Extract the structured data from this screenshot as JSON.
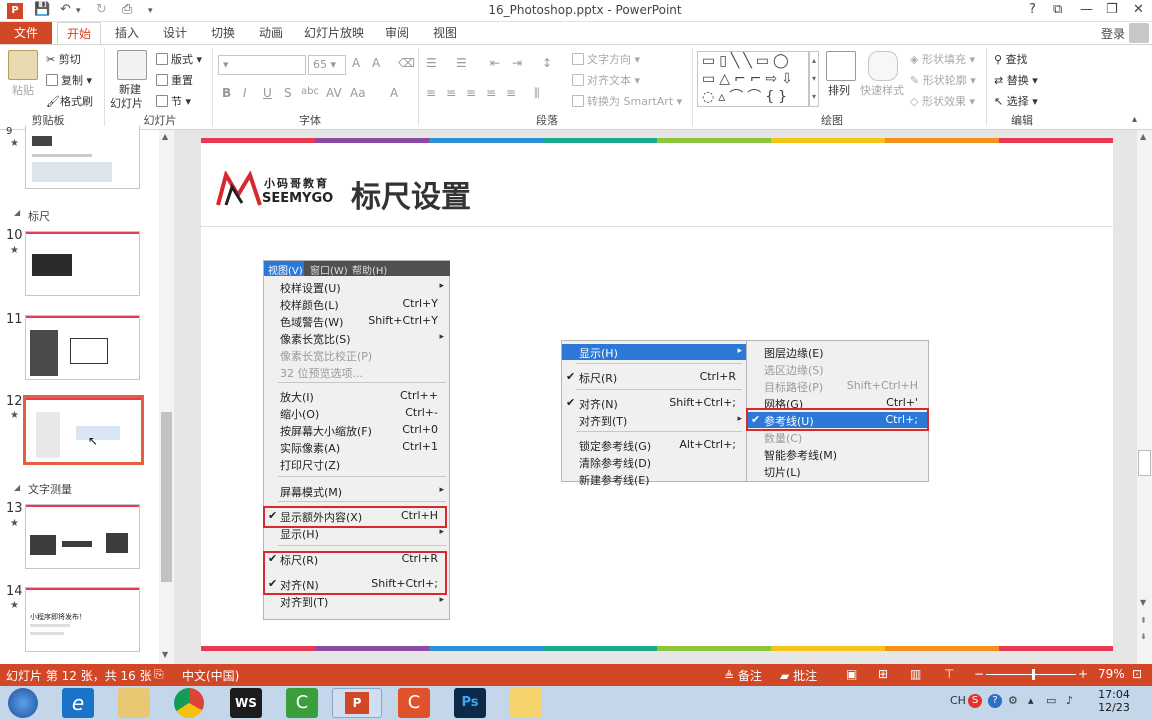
{
  "window": {
    "title": "16_Photoshop.pptx - PowerPoint",
    "app_icon": "P",
    "controls": [
      "?",
      "⧉",
      "—",
      "❐",
      "✕"
    ]
  },
  "tabs": {
    "file": "文件",
    "items": [
      "开始",
      "插入",
      "设计",
      "切换",
      "动画",
      "幻灯片放映",
      "审阅",
      "视图"
    ],
    "active_index": 0,
    "login": "登录"
  },
  "ribbon": {
    "clipboard": {
      "paste": "粘贴",
      "cut": "剪切",
      "copy": "复制",
      "format_painter": "格式刷",
      "label": "剪贴板"
    },
    "slides": {
      "new_slide": "新建",
      "new_slide2": "幻灯片",
      "layout": "版式",
      "reset": "重置",
      "section": "节",
      "label": "幻灯片"
    },
    "font": {
      "size": "65",
      "label": "字体"
    },
    "paragraph": {
      "text_direction": "文字方向",
      "align_text": "对齐文本",
      "convert_smartart": "转换为 SmartArt",
      "label": "段落"
    },
    "drawing": {
      "arrange": "排列",
      "quick_styles": "快速样式",
      "shape_fill": "形状填充",
      "shape_outline": "形状轮廓",
      "shape_effects": "形状效果",
      "label": "绘图"
    },
    "editing": {
      "find": "查找",
      "replace": "替换",
      "select": "选择",
      "label": "编辑"
    }
  },
  "panel": {
    "section_ruler": "标尺",
    "section_text": "文字测量",
    "slides": [
      {
        "num": "9",
        "star": "★"
      },
      {
        "num": "10",
        "star": "★"
      },
      {
        "num": "11",
        "star": ""
      },
      {
        "num": "12",
        "star": "★"
      },
      {
        "num": "13",
        "star": "★"
      },
      {
        "num": "14",
        "star": "★"
      }
    ],
    "thumb14_text": "小程序即将发布！"
  },
  "slide": {
    "logo_cn": "小码哥教育",
    "logo_en": "SEEMYGO",
    "title": "标尺设置",
    "rainbow": [
      "#e73b55",
      "#8a4aa3",
      "#2e8fd3",
      "#1aab8f",
      "#8cc63f",
      "#f5c419",
      "#f39020",
      "#e73b55"
    ],
    "menu1": {
      "bar": [
        "视图(V)",
        "窗口(W)",
        "帮助(H)"
      ],
      "items": [
        {
          "label": "校样设置(U)",
          "shortcut": "",
          "arrow": "▸",
          "dim": false,
          "check": ""
        },
        {
          "label": "校样颜色(L)",
          "shortcut": "Ctrl+Y",
          "arrow": "",
          "dim": false,
          "check": ""
        },
        {
          "label": "色域警告(W)",
          "shortcut": "Shift+Ctrl+Y",
          "arrow": "",
          "dim": false,
          "check": ""
        },
        {
          "label": "像素长宽比(S)",
          "shortcut": "",
          "arrow": "▸",
          "dim": false,
          "check": ""
        },
        {
          "label": "像素长宽比校正(P)",
          "shortcut": "",
          "arrow": "",
          "dim": true,
          "check": ""
        },
        {
          "label": "32 位预览选项...",
          "shortcut": "",
          "arrow": "",
          "dim": true,
          "check": ""
        },
        {
          "label": "放大(I)",
          "shortcut": "Ctrl++",
          "arrow": "",
          "dim": false,
          "check": ""
        },
        {
          "label": "缩小(O)",
          "shortcut": "Ctrl+-",
          "arrow": "",
          "dim": false,
          "check": ""
        },
        {
          "label": "按屏幕大小缩放(F)",
          "shortcut": "Ctrl+0",
          "arrow": "",
          "dim": false,
          "check": ""
        },
        {
          "label": "实际像素(A)",
          "shortcut": "Ctrl+1",
          "arrow": "",
          "dim": false,
          "check": ""
        },
        {
          "label": "打印尺寸(Z)",
          "shortcut": "",
          "arrow": "",
          "dim": false,
          "check": ""
        },
        {
          "label": "屏幕模式(M)",
          "shortcut": "",
          "arrow": "▸",
          "dim": false,
          "check": ""
        },
        {
          "label": "显示额外内容(X)",
          "shortcut": "Ctrl+H",
          "arrow": "",
          "dim": false,
          "check": "✔"
        },
        {
          "label": "显示(H)",
          "shortcut": "",
          "arrow": "▸",
          "dim": false,
          "check": ""
        },
        {
          "label": "标尺(R)",
          "shortcut": "Ctrl+R",
          "arrow": "",
          "dim": false,
          "check": "✔"
        },
        {
          "label": "对齐(N)",
          "shortcut": "Shift+Ctrl+;",
          "arrow": "",
          "dim": false,
          "check": "✔"
        },
        {
          "label": "对齐到(T)",
          "shortcut": "",
          "arrow": "▸",
          "dim": false,
          "check": ""
        }
      ]
    },
    "menu2": {
      "left": [
        {
          "label": "显示(H)",
          "shortcut": "",
          "arrow": "▸",
          "check": ""
        },
        {
          "label": "标尺(R)",
          "shortcut": "Ctrl+R",
          "arrow": "",
          "check": "✔"
        },
        {
          "label": "对齐(N)",
          "shortcut": "Shift+Ctrl+;",
          "arrow": "",
          "check": "✔"
        },
        {
          "label": "对齐到(T)",
          "shortcut": "",
          "arrow": "▸",
          "check": ""
        },
        {
          "label": "锁定参考线(G)",
          "shortcut": "Alt+Ctrl+;",
          "arrow": "",
          "check": ""
        },
        {
          "label": "清除参考线(D)",
          "shortcut": "",
          "arrow": "",
          "check": ""
        },
        {
          "label": "新建参考线(E)",
          "shortcut": "",
          "arrow": "",
          "check": ""
        }
      ],
      "right": [
        {
          "label": "图层边缘(E)",
          "shortcut": "",
          "dim": false,
          "check": ""
        },
        {
          "label": "选区边缘(S)",
          "shortcut": "",
          "dim": true,
          "check": ""
        },
        {
          "label": "目标路径(P)",
          "shortcut": "Shift+Ctrl+H",
          "dim": true,
          "check": ""
        },
        {
          "label": "网格(G)",
          "shortcut": "Ctrl+'",
          "dim": false,
          "check": ""
        },
        {
          "label": "参考线(U)",
          "shortcut": "Ctrl+;",
          "dim": false,
          "check": "✔"
        },
        {
          "label": "数量(C)",
          "shortcut": "",
          "dim": true,
          "check": ""
        },
        {
          "label": "智能参考线(M)",
          "shortcut": "",
          "dim": false,
          "check": ""
        },
        {
          "label": "切片(L)",
          "shortcut": "",
          "dim": false,
          "check": ""
        }
      ]
    }
  },
  "status": {
    "slide_info": "幻灯片 第 12 张，共 16 张",
    "language": "中文(中国)",
    "notes": "备注",
    "comments": "批注",
    "zoom": "79%",
    "zoom_level": 0.79
  },
  "taskbar": {
    "time": "17:04",
    "date": "12/23",
    "ime": "CH",
    "apps": [
      "start",
      "ie",
      "explorer",
      "chrome",
      "webstorm",
      "camtasia",
      "powerpoint",
      "recorder",
      "photoshop",
      "notes"
    ]
  },
  "colors": {
    "accent": "#d24726",
    "highlight": "#2b78d6",
    "redbox": "#d9272e"
  }
}
